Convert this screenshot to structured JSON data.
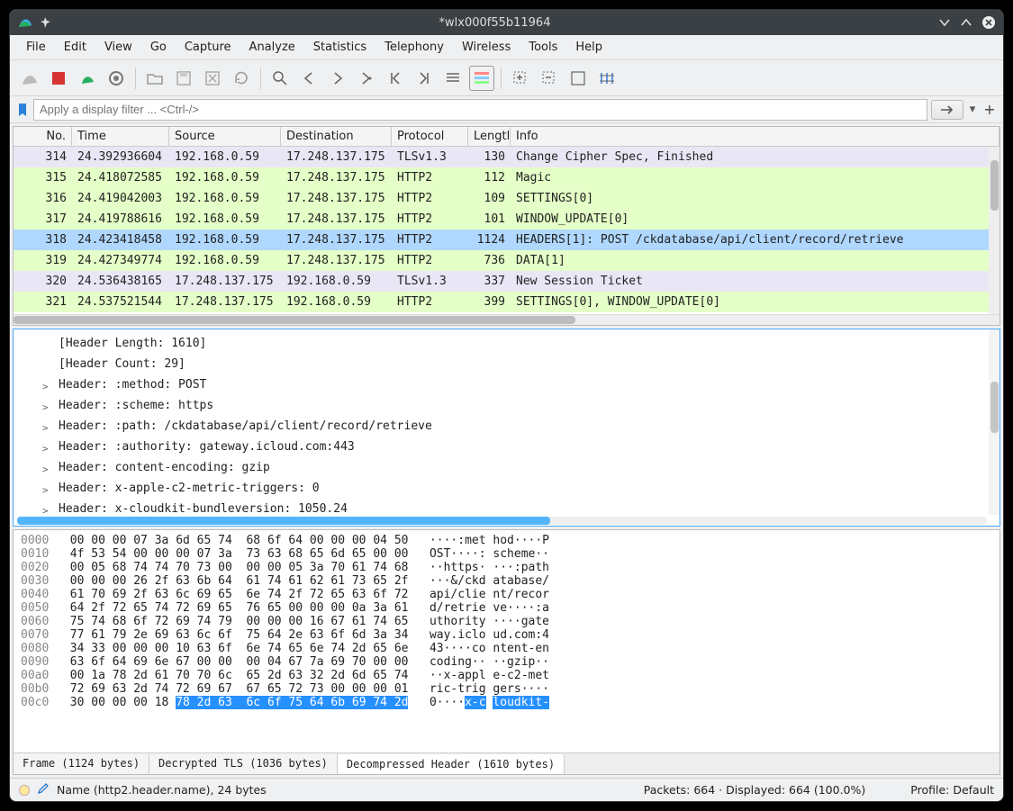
{
  "title": "*wlx000f55b11964",
  "menu": [
    "File",
    "Edit",
    "View",
    "Go",
    "Capture",
    "Analyze",
    "Statistics",
    "Telephony",
    "Wireless",
    "Tools",
    "Help"
  ],
  "filter_placeholder": "Apply a display filter ... <Ctrl-/>",
  "columns": [
    "No.",
    "Time",
    "Source",
    "Destination",
    "Protocol",
    "Lengtl",
    "Info"
  ],
  "packets": [
    {
      "no": "314",
      "time": "24.392936604",
      "src": "192.168.0.59",
      "dst": "17.248.137.175",
      "proto": "TLSv1.3",
      "len": "130",
      "info": "Change Cipher Spec, Finished",
      "bg": "purple"
    },
    {
      "no": "315",
      "time": "24.418072585",
      "src": "192.168.0.59",
      "dst": "17.248.137.175",
      "proto": "HTTP2",
      "len": "112",
      "info": "Magic",
      "bg": "green"
    },
    {
      "no": "316",
      "time": "24.419042003",
      "src": "192.168.0.59",
      "dst": "17.248.137.175",
      "proto": "HTTP2",
      "len": "109",
      "info": "SETTINGS[0]",
      "bg": "green"
    },
    {
      "no": "317",
      "time": "24.419788616",
      "src": "192.168.0.59",
      "dst": "17.248.137.175",
      "proto": "HTTP2",
      "len": "101",
      "info": "WINDOW_UPDATE[0]",
      "bg": "green"
    },
    {
      "no": "318",
      "time": "24.423418458",
      "src": "192.168.0.59",
      "dst": "17.248.137.175",
      "proto": "HTTP2",
      "len": "1124",
      "info": "HEADERS[1]: POST /ckdatabase/api/client/record/retrieve",
      "bg": "sel"
    },
    {
      "no": "319",
      "time": "24.427349774",
      "src": "192.168.0.59",
      "dst": "17.248.137.175",
      "proto": "HTTP2",
      "len": "736",
      "info": "DATA[1]",
      "bg": "green"
    },
    {
      "no": "320",
      "time": "24.536438165",
      "src": "17.248.137.175",
      "dst": "192.168.0.59",
      "proto": "TLSv1.3",
      "len": "337",
      "info": "New Session Ticket",
      "bg": "purple"
    },
    {
      "no": "321",
      "time": "24.537521544",
      "src": "17.248.137.175",
      "dst": "192.168.0.59",
      "proto": "HTTP2",
      "len": "399",
      "info": "SETTINGS[0], WINDOW_UPDATE[0]",
      "bg": "green"
    }
  ],
  "details": [
    {
      "t": "[Header Length: 1610]",
      "exp": ""
    },
    {
      "t": "[Header Count: 29]",
      "exp": ""
    },
    {
      "t": "Header: :method: POST",
      "exp": ">"
    },
    {
      "t": "Header: :scheme: https",
      "exp": ">"
    },
    {
      "t": "Header: :path: /ckdatabase/api/client/record/retrieve",
      "exp": ">"
    },
    {
      "t": "Header: :authority: gateway.icloud.com:443",
      "exp": ">"
    },
    {
      "t": "Header: content-encoding: gzip",
      "exp": ">"
    },
    {
      "t": "Header: x-apple-c2-metric-triggers: 0",
      "exp": ">"
    },
    {
      "t": "Header: x-cloudkit-bundleversion: 1050.24",
      "exp": ">"
    }
  ],
  "hex": [
    {
      "off": "0000",
      "b": "00 00 00 07 3a 6d 65 74  68 6f 64 00 00 00 04 50",
      "a": "····:met hod····P"
    },
    {
      "off": "0010",
      "b": "4f 53 54 00 00 00 07 3a  73 63 68 65 6d 65 00 00",
      "a": "OST····: scheme··"
    },
    {
      "off": "0020",
      "b": "00 05 68 74 74 70 73 00  00 00 05 3a 70 61 74 68",
      "a": "··https· ···:path"
    },
    {
      "off": "0030",
      "b": "00 00 00 26 2f 63 6b 64  61 74 61 62 61 73 65 2f",
      "a": "···&/ckd atabase/"
    },
    {
      "off": "0040",
      "b": "61 70 69 2f 63 6c 69 65  6e 74 2f 72 65 63 6f 72",
      "a": "api/clie nt/recor"
    },
    {
      "off": "0050",
      "b": "64 2f 72 65 74 72 69 65  76 65 00 00 00 0a 3a 61",
      "a": "d/retrie ve····:a"
    },
    {
      "off": "0060",
      "b": "75 74 68 6f 72 69 74 79  00 00 00 16 67 61 74 65",
      "a": "uthority ····gate"
    },
    {
      "off": "0070",
      "b": "77 61 79 2e 69 63 6c 6f  75 64 2e 63 6f 6d 3a 34",
      "a": "way.iclo ud.com:4"
    },
    {
      "off": "0080",
      "b": "34 33 00 00 00 10 63 6f  6e 74 65 6e 74 2d 65 6e",
      "a": "43····co ntent-en"
    },
    {
      "off": "0090",
      "b": "63 6f 64 69 6e 67 00 00  00 04 67 7a 69 70 00 00",
      "a": "coding·· ··gzip··"
    },
    {
      "off": "00a0",
      "b": "00 1a 78 2d 61 70 70 6c  65 2d 63 32 2d 6d 65 74",
      "a": "··x-appl e-c2-met"
    },
    {
      "off": "00b0",
      "b": "72 69 63 2d 74 72 69 67  67 65 72 73 00 00 00 01",
      "a": "ric-trig gers····"
    },
    {
      "off": "00c0",
      "b": "30 00 00 00 18 ",
      "bsel": "78 2d 63  6c 6f 75 64 6b 69 74 2d",
      "a": "0····",
      "a1": "x-c",
      "a1s": " ",
      "a2": "loudkit-"
    }
  ],
  "hex_tabs": [
    "Frame (1124 bytes)",
    "Decrypted TLS (1036 bytes)",
    "Decompressed Header (1610 bytes)"
  ],
  "status": {
    "left": "Name (http2.header.name), 24 bytes",
    "mid": "Packets: 664 · Displayed: 664 (100.0%)",
    "right": "Profile: Default"
  }
}
